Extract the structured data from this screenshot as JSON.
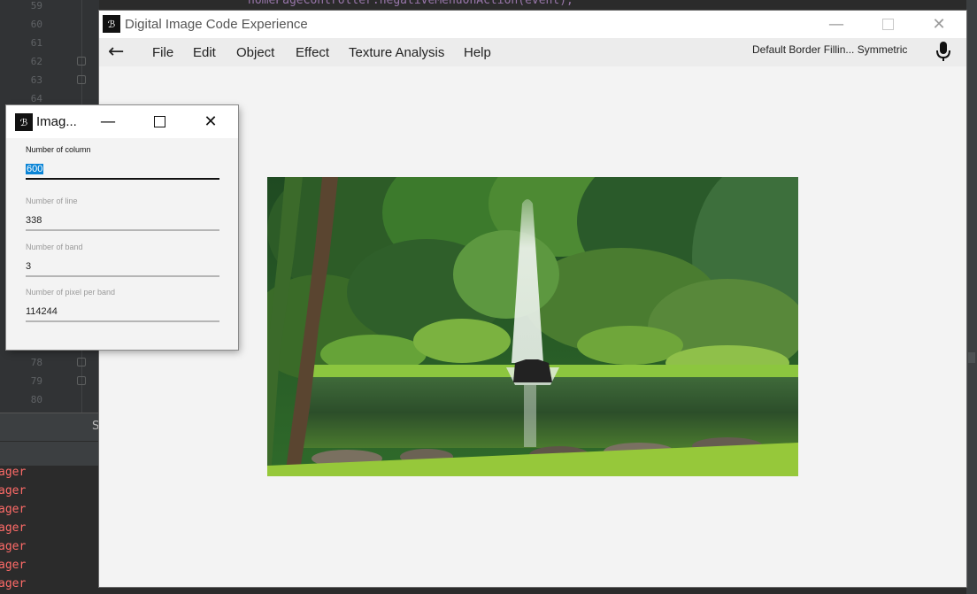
{
  "ide": {
    "code_line": "homePageController.negativeMenuOnAction(event);",
    "line_numbers_top": [
      "59",
      "60",
      "61",
      "62",
      "63",
      "64"
    ],
    "line_numbers_bottom": [
      "78",
      "79",
      "80"
    ],
    "toolbar_partial": "S",
    "console_rows": [
      "ager",
      "ager",
      "ager",
      "ager",
      "ager",
      "ager",
      "ager"
    ]
  },
  "main_window": {
    "title": "Digital Image Code Experience",
    "icon_text": "ℬ",
    "menu": [
      "File",
      "Edit",
      "Object",
      "Effect",
      "Texture Analysis",
      "Help"
    ],
    "border_info": "Default Border Fillin... Symmetric"
  },
  "info_dialog": {
    "title": "Imag...",
    "icon_text": "ℬ",
    "fields": [
      {
        "label": "Number of column",
        "value": "600"
      },
      {
        "label": "Number of line",
        "value": "338"
      },
      {
        "label": "Number of band",
        "value": "3"
      },
      {
        "label": "Number of pixel per band",
        "value": "114244"
      }
    ]
  },
  "colors": {
    "selection": "#0a84d6",
    "console_text": "#ff6b68",
    "code_text": "#9876aa"
  }
}
